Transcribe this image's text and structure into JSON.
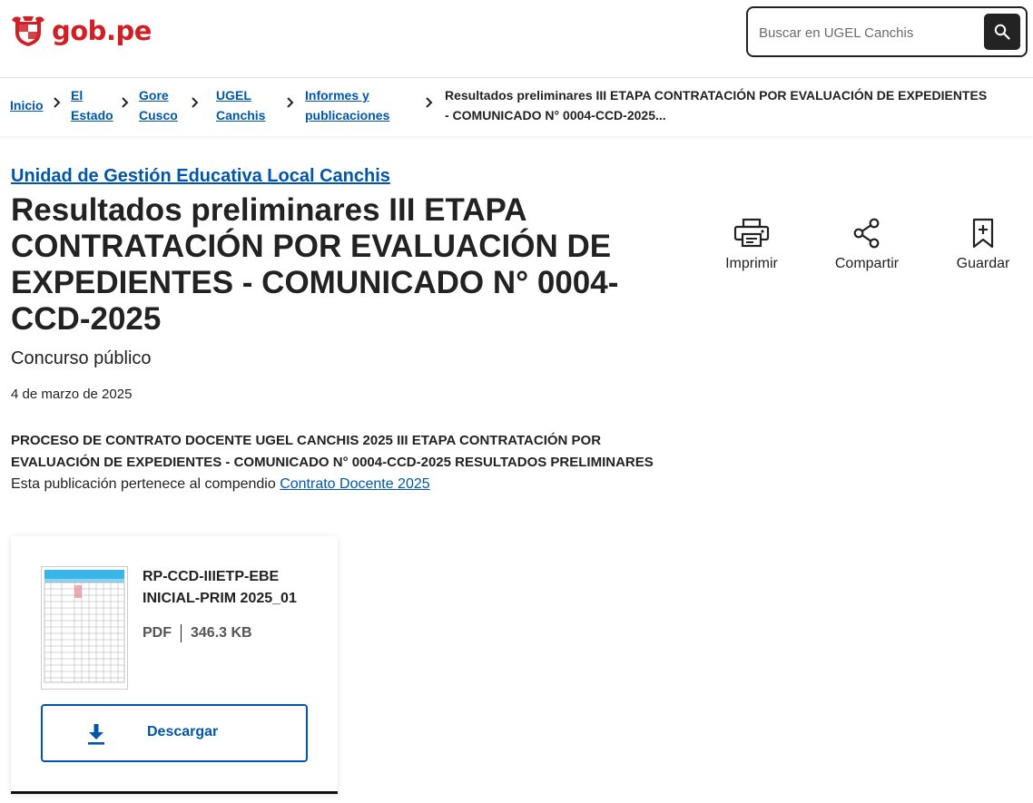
{
  "header": {
    "logo_text": "gob.pe",
    "search": {
      "placeholder": "Buscar en UGEL Canchis"
    }
  },
  "breadcrumb": {
    "items": [
      {
        "label": "Inicio"
      },
      {
        "label_line1": "El",
        "label_line2": "Estado"
      },
      {
        "label_line1": "Gore",
        "label_line2": "Cusco"
      },
      {
        "label_line1": "UGEL",
        "label_line2": "Canchis"
      },
      {
        "label_line1": "Informes y",
        "label_line2": "publicaciones"
      }
    ],
    "current": "Resultados preliminares III ETAPA CONTRATACIÓN POR EVALUACIÓN DE EXPEDIENTES - COMUNICADO N° 0004-CCD-2025..."
  },
  "main": {
    "organization": "Unidad de Gestión Educativa Local Canchis",
    "title": "Resultados preliminares III ETAPA CONTRATACIÓN POR EVALUACIÓN DE EXPEDIENTES - COMUNICADO N° 0004-CCD-2025",
    "subtitle": "Concurso público",
    "date": "4 de marzo de 2025",
    "description": "PROCESO DE CONTRATO DOCENTE UGEL CANCHIS 2025 III ETAPA CONTRATACIÓN POR EVALUACIÓN DE EXPEDIENTES - COMUNICADO N° 0004-CCD-2025 RESULTADOS PRELIMINARES",
    "compendium_prefix": "Esta publicación pertenece al compendio",
    "compendium_link": "Contrato Docente 2025"
  },
  "actions": {
    "print": {
      "label": "Imprimir",
      "icon": "printer-icon"
    },
    "share": {
      "label": "Compartir",
      "icon": "share-icon"
    },
    "save": {
      "label": "Guardar",
      "icon": "bookmark-icon"
    }
  },
  "file": {
    "name": "RP-CCD-IIIETP-EBE INICIAL-PRIM 2025_01",
    "type": "PDF",
    "size": "346.3 KB",
    "download_label": "Descargar"
  },
  "colors": {
    "brand_red": "#d11f26",
    "link_blue": "#0056ac",
    "text": "#222222"
  }
}
